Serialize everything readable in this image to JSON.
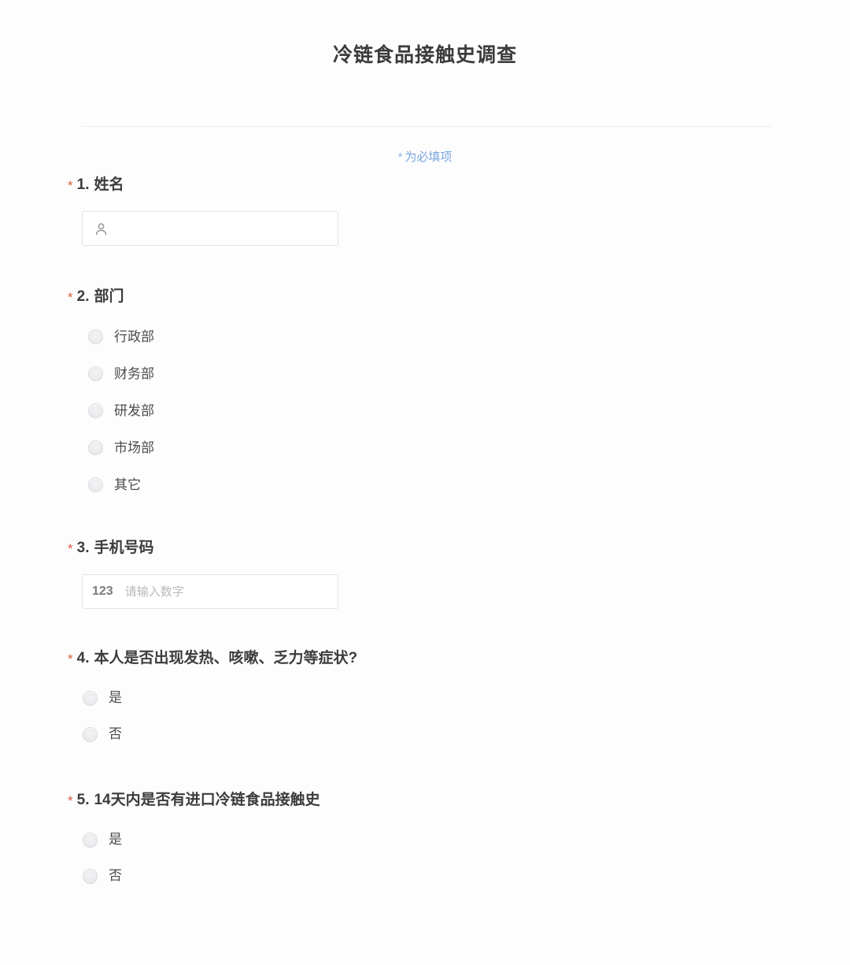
{
  "form": {
    "title": "冷链食品接触史调查",
    "required_note_star": "*",
    "required_note_text": "为必填项",
    "colors": {
      "required_star": "#e05a42",
      "note_text": "#7ba7e0",
      "title_text": "#3b3b3b",
      "input_border": "#e3e3e3",
      "page_background": "#fdfdfd"
    }
  },
  "questions": [
    {
      "index": "1.",
      "label": "姓名",
      "required_star": "*",
      "type": "text",
      "input": {
        "icon": "user-icon",
        "value": "",
        "placeholder": ""
      }
    },
    {
      "index": "2.",
      "label": "部门",
      "required_star": "*",
      "type": "radio",
      "options": [
        {
          "label": "行政部",
          "selected": false
        },
        {
          "label": "财务部",
          "selected": false
        },
        {
          "label": "研发部",
          "selected": false
        },
        {
          "label": "市场部",
          "selected": false
        },
        {
          "label": "其它",
          "selected": false
        }
      ]
    },
    {
      "index": "3.",
      "label": "手机号码",
      "required_star": "*",
      "type": "number",
      "input": {
        "icon": "123",
        "value": "",
        "placeholder": "请输入数字"
      }
    },
    {
      "index": "4.",
      "label": "本人是否出现发热、咳嗽、乏力等症状?",
      "required_star": "*",
      "type": "radio",
      "options": [
        {
          "label": "是",
          "selected": false
        },
        {
          "label": "否",
          "selected": false
        }
      ]
    },
    {
      "index": "5.",
      "label": "14天内是否有进口冷链食品接触史",
      "required_star": "*",
      "type": "radio",
      "options": [
        {
          "label": "是",
          "selected": false
        },
        {
          "label": "否",
          "selected": false
        }
      ]
    }
  ]
}
